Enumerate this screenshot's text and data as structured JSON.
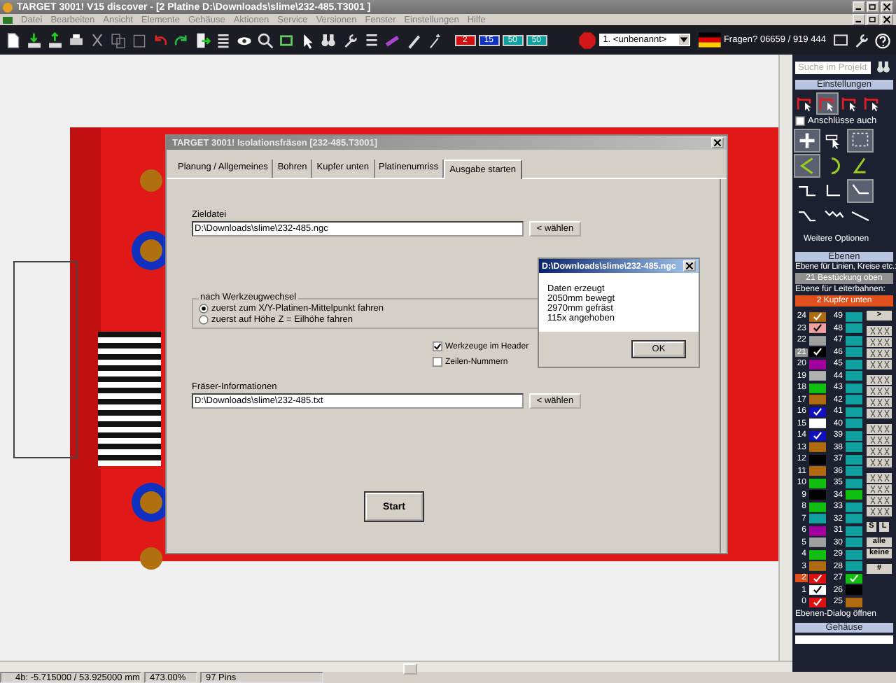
{
  "window": {
    "title": "TARGET 3001! V15 discover - [2 Platine D:\\Downloads\\slime\\232-485.T3001 ]"
  },
  "menu": [
    "Datei",
    "Bearbeiten",
    "Ansicht",
    "Elemente",
    "Gehäuse",
    "Aktionen",
    "Service",
    "Versionen",
    "Fenster",
    "Einstellungen",
    "Hilfe"
  ],
  "toolbar": {
    "layer_buttons": [
      {
        "label": "2",
        "color": "#d01010"
      },
      {
        "label": "15",
        "color": "#1030c0"
      },
      {
        "label": "50",
        "color": "#10a0a0"
      },
      {
        "label": "50",
        "color": "#10a0a0"
      }
    ],
    "project_dropdown": "1. <unbenannt>",
    "hotline": "Fragen? 06659 / 919 444"
  },
  "dialog": {
    "title": "TARGET 3001! Isolationsfräsen [232-485.T3001]",
    "tabs": [
      {
        "label": "Planung / Allgemeines",
        "selected": false
      },
      {
        "label": "Bohren",
        "selected": false
      },
      {
        "label": "Kupfer unten",
        "selected": false
      },
      {
        "label": "Platinenumriss",
        "selected": false
      },
      {
        "label": "Ausgabe starten",
        "selected": true
      }
    ],
    "target_label": "Zieldatei",
    "target_value": "D:\\Downloads\\slime\\232-485.ngc",
    "choose_label": "< wählen",
    "group_title": "nach Werkzeugwechsel",
    "radios": [
      {
        "label": "zuerst zum X/Y-Platinen-Mittelpunkt fahren",
        "selected": true
      },
      {
        "label": "zuerst auf Höhe Z = Eilhöhe fahren",
        "selected": false
      }
    ],
    "checkboxes": [
      {
        "label": "Werkzeuge im Header",
        "checked": true
      },
      {
        "label": "Zeilen-Nummern",
        "checked": false
      }
    ],
    "info_label": "Fräser-Informationen",
    "info_value": "D:\\Downloads\\slime\\232-485.txt",
    "info_choose_label": "< wählen",
    "start_label": "Start"
  },
  "message": {
    "title": "D:\\Downloads\\slime\\232-485.ngc",
    "lines": [
      "Daten erzeugt",
      "2050mm bewegt",
      "2970mm gefräst",
      "115x angehoben"
    ],
    "ok_label": "OK"
  },
  "panel": {
    "search_placeholder": "Suche im Projekt",
    "settings_header": "Einstellungen",
    "tools": [
      [
        {
          "kind": "corner",
          "selected": false
        },
        {
          "kind": "corner",
          "selected": true
        },
        {
          "kind": "corner",
          "selected": false
        },
        {
          "kind": "corner",
          "selected": false
        }
      ]
    ],
    "connections": {
      "label": "Anschlüsse auch",
      "checked": false
    },
    "tools2": [
      [
        {
          "kind": "plus",
          "selected": true
        },
        {
          "kind": "cursor",
          "selected": false
        },
        {
          "kind": "dotted-box",
          "selected": true
        }
      ],
      [
        {
          "kind": "angle",
          "selected": true
        },
        {
          "kind": "arc",
          "selected": false
        },
        {
          "kind": "arc-angle",
          "selected": false
        }
      ],
      [
        {
          "kind": "step",
          "selected": false
        },
        {
          "kind": "step-down",
          "selected": false
        },
        {
          "kind": "chamfer",
          "selected": true
        }
      ],
      [
        {
          "kind": "diag",
          "selected": false
        },
        {
          "kind": "zigzag",
          "selected": false
        },
        {
          "kind": "line",
          "selected": false
        }
      ]
    ],
    "more_options": "Weitere Optionen",
    "layers_header": "Ebenen",
    "line_layer_label": "Ebene für Linien, Kreise etc.:",
    "line_layer": "21 Bestückung oben",
    "track_layer_label": "Ebene für Leiterbahnen:",
    "track_layer": "2 Kupfer unten",
    "layer_rows": [
      {
        "left": {
          "num": "24",
          "color": "#b06a10",
          "checked": true
        },
        "right": {
          "num": "49",
          "color": "#10a0a0",
          "checked": false
        }
      },
      {
        "left": {
          "num": "23",
          "color": "#f0a0a0",
          "checked": true
        },
        "right": {
          "num": "48",
          "color": "#10a0a0",
          "checked": false
        }
      },
      {
        "left": {
          "num": "22",
          "color": "#a0a0a0",
          "checked": false
        },
        "right": {
          "num": "47",
          "color": "#10a0a0",
          "checked": false
        }
      },
      {
        "left": {
          "num": "21",
          "color": "#000000",
          "checked": true
        },
        "right": {
          "num": "46",
          "color": "#10a0a0",
          "checked": false
        },
        "line_layer": true
      },
      {
        "left": {
          "num": "20",
          "color": "#a000a0",
          "checked": false
        },
        "right": {
          "num": "45",
          "color": "#10a0a0",
          "checked": false
        }
      },
      {
        "left": {
          "num": "19",
          "color": "#b0b0b0",
          "checked": false
        },
        "right": {
          "num": "44",
          "color": "#10a0a0",
          "checked": false
        }
      },
      {
        "left": {
          "num": "18",
          "color": "#10c010",
          "checked": false
        },
        "right": {
          "num": "43",
          "color": "#10a0a0",
          "checked": false
        }
      },
      {
        "left": {
          "num": "17",
          "color": "#b06a10",
          "checked": false
        },
        "right": {
          "num": "42",
          "color": "#10a0a0",
          "checked": false
        }
      },
      {
        "left": {
          "num": "16",
          "color": "#1010c0",
          "checked": true
        },
        "right": {
          "num": "41",
          "color": "#10a0a0",
          "checked": false
        }
      },
      {
        "left": {
          "num": "15",
          "color": "#ffffff",
          "checked": false
        },
        "right": {
          "num": "40",
          "color": "#10a0a0",
          "checked": false
        }
      },
      {
        "left": {
          "num": "14",
          "color": "#1010c0",
          "checked": true
        },
        "right": {
          "num": "39",
          "color": "#10a0a0",
          "checked": false
        }
      },
      {
        "left": {
          "num": "13",
          "color": "#b06a10",
          "checked": false
        },
        "right": {
          "num": "38",
          "color": "#10a0a0",
          "checked": false
        }
      },
      {
        "left": {
          "num": "12",
          "color": "#000000",
          "checked": false
        },
        "right": {
          "num": "37",
          "color": "#10a0a0",
          "checked": false
        }
      },
      {
        "left": {
          "num": "11",
          "color": "#b06a10",
          "checked": false
        },
        "right": {
          "num": "36",
          "color": "#10a0a0",
          "checked": false
        }
      },
      {
        "left": {
          "num": "10",
          "color": "#10c010",
          "checked": false
        },
        "right": {
          "num": "35",
          "color": "#10a0a0",
          "checked": false
        }
      },
      {
        "left": {
          "num": "9",
          "color": "#000000",
          "checked": false
        },
        "right": {
          "num": "34",
          "color": "#10c010",
          "checked": false
        }
      },
      {
        "left": {
          "num": "8",
          "color": "#10c010",
          "checked": false
        },
        "right": {
          "num": "33",
          "color": "#10a0a0",
          "checked": false
        }
      },
      {
        "left": {
          "num": "7",
          "color": "#10a0a0",
          "checked": false
        },
        "right": {
          "num": "32",
          "color": "#10a0a0",
          "checked": false
        }
      },
      {
        "left": {
          "num": "6",
          "color": "#a000a0",
          "checked": false
        },
        "right": {
          "num": "31",
          "color": "#10a0a0",
          "checked": false
        }
      },
      {
        "left": {
          "num": "5",
          "color": "#a0a0a0",
          "checked": false
        },
        "right": {
          "num": "30",
          "color": "#10a0a0",
          "checked": false
        }
      },
      {
        "left": {
          "num": "4",
          "color": "#10c010",
          "checked": false
        },
        "right": {
          "num": "29",
          "color": "#10a0a0",
          "checked": false
        }
      },
      {
        "left": {
          "num": "3",
          "color": "#b06a10",
          "checked": false
        },
        "right": {
          "num": "28",
          "color": "#10a0a0",
          "checked": false
        }
      },
      {
        "left": {
          "num": "2",
          "color": "#e01010",
          "checked": true
        },
        "right": {
          "num": "27",
          "color": "#10c010",
          "checked": true
        },
        "track_layer": true
      },
      {
        "left": {
          "num": "1",
          "color": "#ffffff",
          "checked": true
        },
        "right": {
          "num": "26",
          "color": "#000000",
          "checked": false
        }
      },
      {
        "left": {
          "num": "0",
          "color": "#e01010",
          "checked": true
        },
        "right": {
          "num": "25",
          "color": "#b06a10",
          "checked": false
        }
      }
    ],
    "side_groups": [
      [
        {
          "kind": "text",
          "label": ">"
        }
      ],
      [
        {
          "kind": "pattern"
        },
        {
          "kind": "pattern"
        },
        {
          "kind": "pattern"
        },
        {
          "kind": "pattern"
        }
      ],
      [
        {
          "kind": "pattern"
        },
        {
          "kind": "pattern"
        },
        {
          "kind": "pattern"
        },
        {
          "kind": "pattern"
        }
      ],
      [
        {
          "kind": "pattern"
        },
        {
          "kind": "pattern"
        },
        {
          "kind": "pattern"
        },
        {
          "kind": "pattern"
        }
      ],
      [
        {
          "kind": "pattern"
        },
        {
          "kind": "pattern"
        },
        {
          "kind": "pattern"
        },
        {
          "kind": "pattern"
        }
      ],
      [
        {
          "kind": "small",
          "label": "S"
        },
        {
          "kind": "small",
          "label": "L"
        }
      ],
      [
        {
          "kind": "text",
          "label": "alle"
        },
        {
          "kind": "text",
          "label": "keine"
        }
      ],
      [
        {
          "kind": "text",
          "label": "#"
        }
      ]
    ],
    "layer_dialog_link": "Ebenen-Dialog öffnen",
    "housing_header": "Gehäuse"
  },
  "status_bar": [
    "4b: -5.715000 / 53.925000 mm",
    "473.00%",
    "97 Pins"
  ]
}
